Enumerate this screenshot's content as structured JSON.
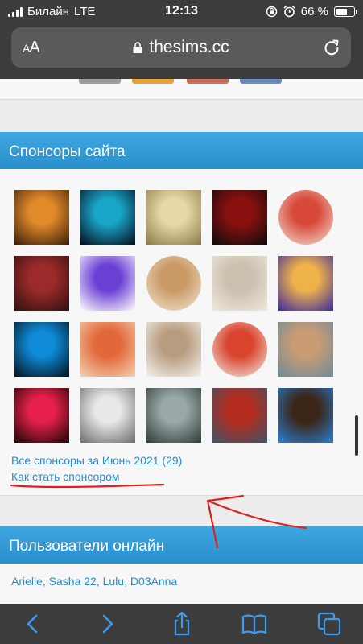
{
  "status_bar": {
    "carrier": "Билайн",
    "network": "LTE",
    "time": "12:13",
    "battery_percent": "66 %",
    "battery_level": 0.66
  },
  "address_bar": {
    "reader_label_small": "A",
    "reader_label_large": "A",
    "url": "thesims.cc"
  },
  "sponsors": {
    "title": "Спонсоры сайта",
    "avatars": [
      {
        "name": "cat-film-avatar",
        "shape": "square",
        "colors": [
          "#e08a2a",
          "#3a1e08"
        ]
      },
      {
        "name": "blue-portal-avatar",
        "shape": "square",
        "colors": [
          "#1aa6c9",
          "#050a18"
        ]
      },
      {
        "name": "warrior-angel-avatar",
        "shape": "square",
        "colors": [
          "#e8d9a8",
          "#8c7a4a"
        ]
      },
      {
        "name": "masked-man-avatar",
        "shape": "square",
        "colors": [
          "#8a1010",
          "#0c0c0c"
        ]
      },
      {
        "name": "carnival-mask-avatar",
        "shape": "round",
        "colors": [
          "#d8493a",
          "#f2e4d6"
        ]
      },
      {
        "name": "red-hair-woman-avatar",
        "shape": "square",
        "colors": [
          "#9c2a2a",
          "#2e1010"
        ]
      },
      {
        "name": "purple-butterfly-avatar",
        "shape": "square",
        "colors": [
          "#6a3fd4",
          "#ffffff"
        ]
      },
      {
        "name": "girl-portrait-avatar",
        "shape": "round",
        "colors": [
          "#c99a66",
          "#f3e7d6"
        ]
      },
      {
        "name": "sketch-girl-avatar",
        "shape": "square",
        "colors": [
          "#cbbfae",
          "#efe8dc"
        ]
      },
      {
        "name": "cartoon-character-avatar",
        "shape": "square",
        "colors": [
          "#f0b34a",
          "#3b2a9e"
        ]
      },
      {
        "name": "blue-hair-avatar",
        "shape": "square",
        "colors": [
          "#0f8ad6",
          "#05121e"
        ]
      },
      {
        "name": "flower-woman-avatar",
        "shape": "square",
        "colors": [
          "#e2673a",
          "#f3d1b0"
        ]
      },
      {
        "name": "deer-avatar",
        "shape": "square",
        "colors": [
          "#b89c80",
          "#f5f2ec"
        ]
      },
      {
        "name": "redhead-heart-avatar",
        "shape": "round",
        "colors": [
          "#d9442e",
          "#f4efe8"
        ]
      },
      {
        "name": "sim-woman-avatar",
        "shape": "square",
        "colors": [
          "#c99c74",
          "#6f8a9a"
        ]
      },
      {
        "name": "red-magic-avatar",
        "shape": "square",
        "colors": [
          "#e6204a",
          "#1a0505"
        ]
      },
      {
        "name": "white-fox-avatar",
        "shape": "square",
        "colors": [
          "#e8e8e8",
          "#6c6c6c"
        ]
      },
      {
        "name": "winter-forest-avatar",
        "shape": "square",
        "colors": [
          "#9aa8a8",
          "#2e3a36"
        ]
      },
      {
        "name": "sim-redhead-avatar",
        "shape": "square",
        "colors": [
          "#b52c20",
          "#3e5466"
        ]
      },
      {
        "name": "sunglasses-man-avatar",
        "shape": "square",
        "colors": [
          "#3b2516",
          "#2a7fd6"
        ]
      }
    ],
    "all_sponsors_link": "Все спонсоры за Июнь 2021 (29)",
    "become_sponsor_link": "Как стать спонсором"
  },
  "online": {
    "title": "Пользователи онлайн",
    "users_text": "Arielle, Sasha 22, Lulu, D03Anna"
  },
  "colors": {
    "header_blue": "#2a8fcd",
    "link_blue": "#2b8ccb",
    "annotation_red": "#e0201a"
  },
  "toolbar": {
    "back": "chevron-left-icon",
    "forward": "chevron-right-icon",
    "share": "share-icon",
    "bookmarks": "book-icon",
    "tabs": "tabs-icon"
  }
}
